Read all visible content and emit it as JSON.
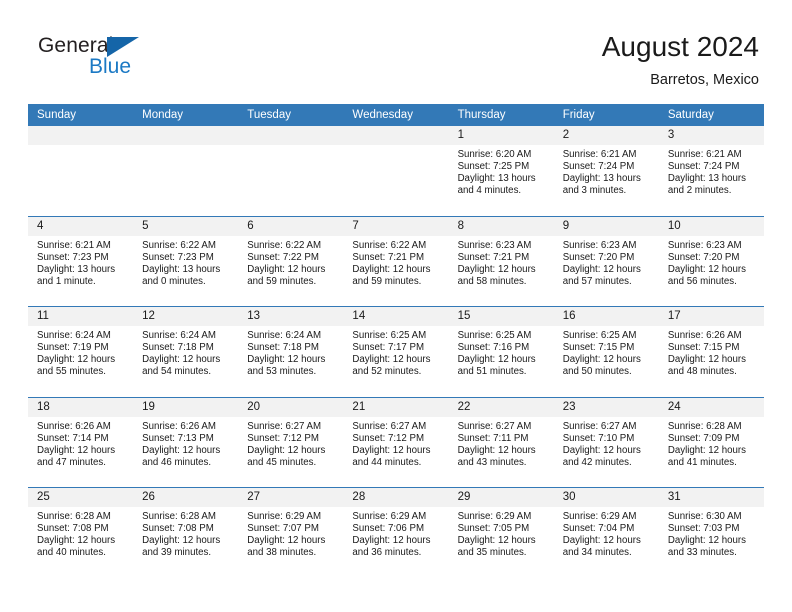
{
  "brand": {
    "name_top": "General",
    "name_bottom": "Blue",
    "triangle_color": "#1565a8",
    "blue_text_color": "#1b79c4"
  },
  "header": {
    "title": "August 2024",
    "subtitle": "Barretos, Mexico"
  },
  "theme": {
    "header_band": "#3379b7",
    "day_band": "#f2f2f2",
    "text": "#1a1a1a"
  },
  "weekday_headers": [
    "Sunday",
    "Monday",
    "Tuesday",
    "Wednesday",
    "Thursday",
    "Friday",
    "Saturday"
  ],
  "weeks": [
    [
      {
        "day": "",
        "sunrise": "",
        "sunset": "",
        "daylight": "",
        "daylight2": "",
        "empty": true
      },
      {
        "day": "",
        "sunrise": "",
        "sunset": "",
        "daylight": "",
        "daylight2": "",
        "empty": true
      },
      {
        "day": "",
        "sunrise": "",
        "sunset": "",
        "daylight": "",
        "daylight2": "",
        "empty": true
      },
      {
        "day": "",
        "sunrise": "",
        "sunset": "",
        "daylight": "",
        "daylight2": "",
        "empty": true
      },
      {
        "day": "1",
        "sunrise": "Sunrise: 6:20 AM",
        "sunset": "Sunset: 7:25 PM",
        "daylight": "Daylight: 13 hours",
        "daylight2": "and 4 minutes."
      },
      {
        "day": "2",
        "sunrise": "Sunrise: 6:21 AM",
        "sunset": "Sunset: 7:24 PM",
        "daylight": "Daylight: 13 hours",
        "daylight2": "and 3 minutes."
      },
      {
        "day": "3",
        "sunrise": "Sunrise: 6:21 AM",
        "sunset": "Sunset: 7:24 PM",
        "daylight": "Daylight: 13 hours",
        "daylight2": "and 2 minutes."
      }
    ],
    [
      {
        "day": "4",
        "sunrise": "Sunrise: 6:21 AM",
        "sunset": "Sunset: 7:23 PM",
        "daylight": "Daylight: 13 hours",
        "daylight2": "and 1 minute."
      },
      {
        "day": "5",
        "sunrise": "Sunrise: 6:22 AM",
        "sunset": "Sunset: 7:23 PM",
        "daylight": "Daylight: 13 hours",
        "daylight2": "and 0 minutes."
      },
      {
        "day": "6",
        "sunrise": "Sunrise: 6:22 AM",
        "sunset": "Sunset: 7:22 PM",
        "daylight": "Daylight: 12 hours",
        "daylight2": "and 59 minutes."
      },
      {
        "day": "7",
        "sunrise": "Sunrise: 6:22 AM",
        "sunset": "Sunset: 7:21 PM",
        "daylight": "Daylight: 12 hours",
        "daylight2": "and 59 minutes."
      },
      {
        "day": "8",
        "sunrise": "Sunrise: 6:23 AM",
        "sunset": "Sunset: 7:21 PM",
        "daylight": "Daylight: 12 hours",
        "daylight2": "and 58 minutes."
      },
      {
        "day": "9",
        "sunrise": "Sunrise: 6:23 AM",
        "sunset": "Sunset: 7:20 PM",
        "daylight": "Daylight: 12 hours",
        "daylight2": "and 57 minutes."
      },
      {
        "day": "10",
        "sunrise": "Sunrise: 6:23 AM",
        "sunset": "Sunset: 7:20 PM",
        "daylight": "Daylight: 12 hours",
        "daylight2": "and 56 minutes."
      }
    ],
    [
      {
        "day": "11",
        "sunrise": "Sunrise: 6:24 AM",
        "sunset": "Sunset: 7:19 PM",
        "daylight": "Daylight: 12 hours",
        "daylight2": "and 55 minutes."
      },
      {
        "day": "12",
        "sunrise": "Sunrise: 6:24 AM",
        "sunset": "Sunset: 7:18 PM",
        "daylight": "Daylight: 12 hours",
        "daylight2": "and 54 minutes."
      },
      {
        "day": "13",
        "sunrise": "Sunrise: 6:24 AM",
        "sunset": "Sunset: 7:18 PM",
        "daylight": "Daylight: 12 hours",
        "daylight2": "and 53 minutes."
      },
      {
        "day": "14",
        "sunrise": "Sunrise: 6:25 AM",
        "sunset": "Sunset: 7:17 PM",
        "daylight": "Daylight: 12 hours",
        "daylight2": "and 52 minutes."
      },
      {
        "day": "15",
        "sunrise": "Sunrise: 6:25 AM",
        "sunset": "Sunset: 7:16 PM",
        "daylight": "Daylight: 12 hours",
        "daylight2": "and 51 minutes."
      },
      {
        "day": "16",
        "sunrise": "Sunrise: 6:25 AM",
        "sunset": "Sunset: 7:15 PM",
        "daylight": "Daylight: 12 hours",
        "daylight2": "and 50 minutes."
      },
      {
        "day": "17",
        "sunrise": "Sunrise: 6:26 AM",
        "sunset": "Sunset: 7:15 PM",
        "daylight": "Daylight: 12 hours",
        "daylight2": "and 48 minutes."
      }
    ],
    [
      {
        "day": "18",
        "sunrise": "Sunrise: 6:26 AM",
        "sunset": "Sunset: 7:14 PM",
        "daylight": "Daylight: 12 hours",
        "daylight2": "and 47 minutes."
      },
      {
        "day": "19",
        "sunrise": "Sunrise: 6:26 AM",
        "sunset": "Sunset: 7:13 PM",
        "daylight": "Daylight: 12 hours",
        "daylight2": "and 46 minutes."
      },
      {
        "day": "20",
        "sunrise": "Sunrise: 6:27 AM",
        "sunset": "Sunset: 7:12 PM",
        "daylight": "Daylight: 12 hours",
        "daylight2": "and 45 minutes."
      },
      {
        "day": "21",
        "sunrise": "Sunrise: 6:27 AM",
        "sunset": "Sunset: 7:12 PM",
        "daylight": "Daylight: 12 hours",
        "daylight2": "and 44 minutes."
      },
      {
        "day": "22",
        "sunrise": "Sunrise: 6:27 AM",
        "sunset": "Sunset: 7:11 PM",
        "daylight": "Daylight: 12 hours",
        "daylight2": "and 43 minutes."
      },
      {
        "day": "23",
        "sunrise": "Sunrise: 6:27 AM",
        "sunset": "Sunset: 7:10 PM",
        "daylight": "Daylight: 12 hours",
        "daylight2": "and 42 minutes."
      },
      {
        "day": "24",
        "sunrise": "Sunrise: 6:28 AM",
        "sunset": "Sunset: 7:09 PM",
        "daylight": "Daylight: 12 hours",
        "daylight2": "and 41 minutes."
      }
    ],
    [
      {
        "day": "25",
        "sunrise": "Sunrise: 6:28 AM",
        "sunset": "Sunset: 7:08 PM",
        "daylight": "Daylight: 12 hours",
        "daylight2": "and 40 minutes."
      },
      {
        "day": "26",
        "sunrise": "Sunrise: 6:28 AM",
        "sunset": "Sunset: 7:08 PM",
        "daylight": "Daylight: 12 hours",
        "daylight2": "and 39 minutes."
      },
      {
        "day": "27",
        "sunrise": "Sunrise: 6:29 AM",
        "sunset": "Sunset: 7:07 PM",
        "daylight": "Daylight: 12 hours",
        "daylight2": "and 38 minutes."
      },
      {
        "day": "28",
        "sunrise": "Sunrise: 6:29 AM",
        "sunset": "Sunset: 7:06 PM",
        "daylight": "Daylight: 12 hours",
        "daylight2": "and 36 minutes."
      },
      {
        "day": "29",
        "sunrise": "Sunrise: 6:29 AM",
        "sunset": "Sunset: 7:05 PM",
        "daylight": "Daylight: 12 hours",
        "daylight2": "and 35 minutes."
      },
      {
        "day": "30",
        "sunrise": "Sunrise: 6:29 AM",
        "sunset": "Sunset: 7:04 PM",
        "daylight": "Daylight: 12 hours",
        "daylight2": "and 34 minutes."
      },
      {
        "day": "31",
        "sunrise": "Sunrise: 6:30 AM",
        "sunset": "Sunset: 7:03 PM",
        "daylight": "Daylight: 12 hours",
        "daylight2": "and 33 minutes."
      }
    ]
  ]
}
